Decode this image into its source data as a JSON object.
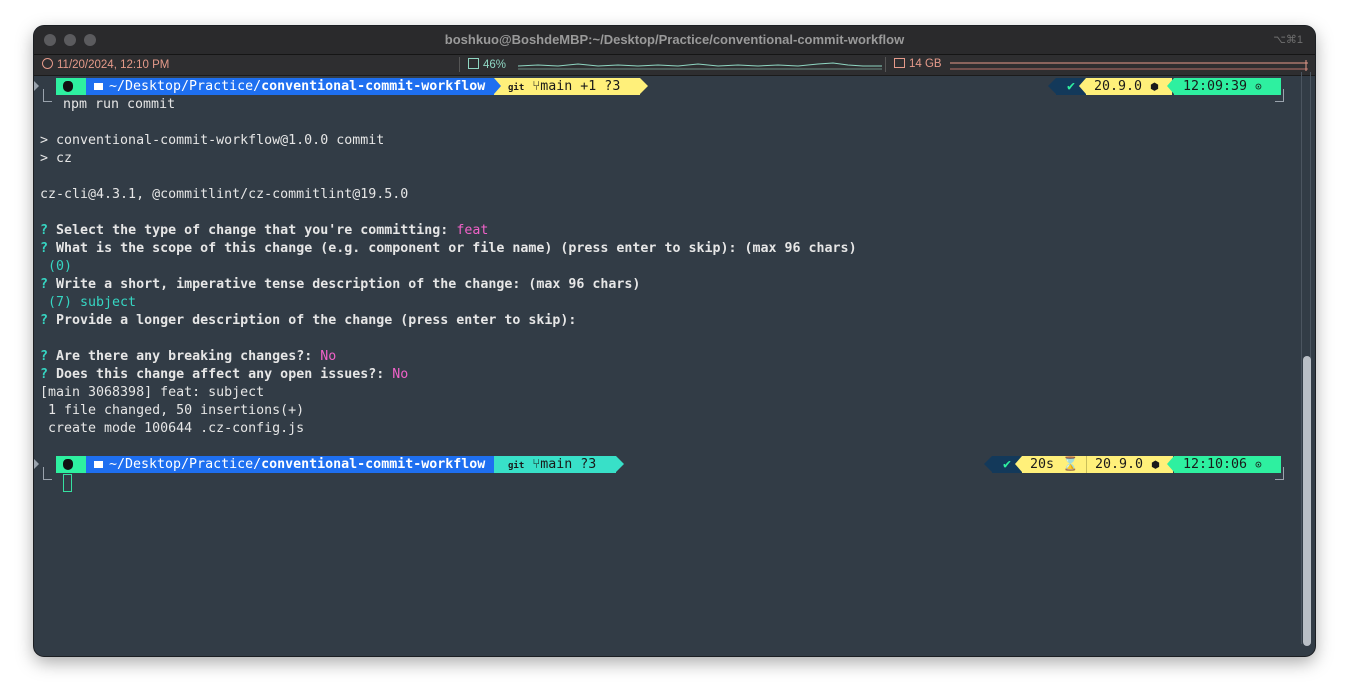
{
  "window": {
    "title": "boshkuo@BoshdeMBP:~/Desktop/Practice/conventional-commit-workflow",
    "shortcut": "⌥⌘1"
  },
  "statusbar": {
    "clock": "11/20/2024, 12:10 PM",
    "cpu": "46%",
    "memory": "14 GB"
  },
  "prompt1": {
    "path_prefix": "~/Desktop/Practice/",
    "path_dir": "conventional-commit-workflow",
    "git_label": "git",
    "branch": "main +1 ?3",
    "status": "✔",
    "node": "20.9.0",
    "time": "12:09:39",
    "command": "npm run commit"
  },
  "output": {
    "l1": "> conventional-commit-workflow@1.0.0 commit",
    "l2": "> cz",
    "l3": "cz-cli@4.3.1, @commitlint/cz-commitlint@19.5.0",
    "q1": "Select the type of change that you're committing: ",
    "q1_ans": "feat",
    "q2": "What is the scope of this change (e.g. component or file name) (press enter to skip): (max 96 chars)",
    "q2_ans": " (0)",
    "q3": "Write a short, imperative tense description of the change: (max 96 chars)",
    "q3_ans": " (7) subject",
    "q4": "Provide a longer description of the change (press enter to skip):",
    "q5": "Are there any breaking changes?: ",
    "q5_ans": "No",
    "q6": "Does this change affect any open issues?: ",
    "q6_ans": "No",
    "r1": "[main 3068398] feat: subject",
    "r2": " 1 file changed, 50 insertions(+)",
    "r3": " create mode 100644 .cz-config.js",
    "qmark": "?"
  },
  "prompt2": {
    "path_prefix": "~/Desktop/Practice/",
    "path_dir": "conventional-commit-workflow",
    "git_label": "git",
    "branch": "main ?3",
    "status": "✔",
    "duration": "20s",
    "node": "20.9.0",
    "time": "12:10:06"
  },
  "colors": {
    "apple_seg": "#2ef0a0",
    "path_seg": "#1e6ff0",
    "git_seg_dirty": "#fff07a",
    "git_seg_clean": "#38e0c8",
    "status_seg": "#13395a",
    "duration_seg": "#fff07a",
    "node_seg": "#fff07a",
    "time_seg": "#2ef0a0"
  }
}
